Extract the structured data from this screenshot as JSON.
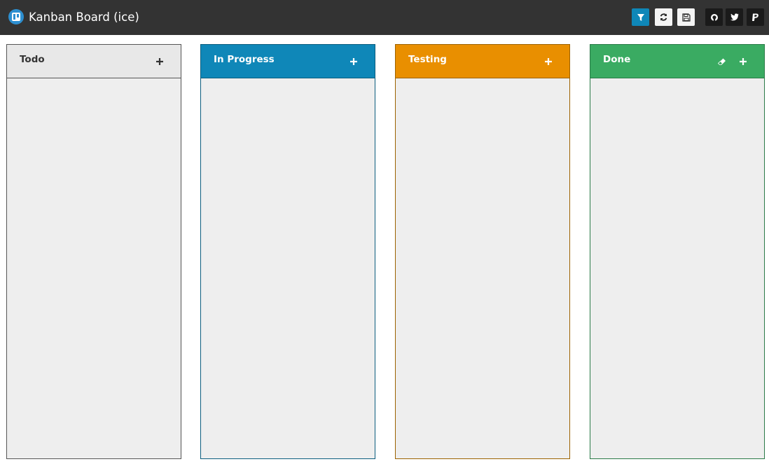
{
  "app": {
    "title": "Kanban Board (ice)",
    "logo_icon": "trello-icon"
  },
  "toolbar": {
    "buttons": [
      {
        "icon": "filter-icon",
        "active": true
      },
      {
        "icon": "refresh-icon"
      },
      {
        "icon": "save-icon"
      },
      {
        "icon": "github-icon"
      },
      {
        "icon": "twitter-icon"
      },
      {
        "icon": "paypal-icon"
      }
    ]
  },
  "columns": [
    {
      "title": "Todo",
      "color": "#e8e8e8",
      "border": "#555555",
      "text_color": "#333333",
      "actions": [
        "add"
      ],
      "cards": []
    },
    {
      "title": "In Progress",
      "color": "#0f87b8",
      "border": "#0b5d7e",
      "text_color": "#ffffff",
      "actions": [
        "add"
      ],
      "cards": []
    },
    {
      "title": "Testing",
      "color": "#e98f00",
      "border": "#9c6200",
      "text_color": "#ffffff",
      "actions": [
        "add"
      ],
      "cards": []
    },
    {
      "title": "Done",
      "color": "#3aab62",
      "border": "#2a7a47",
      "text_color": "#ffffff",
      "actions": [
        "clear",
        "add"
      ],
      "cards": []
    }
  ]
}
